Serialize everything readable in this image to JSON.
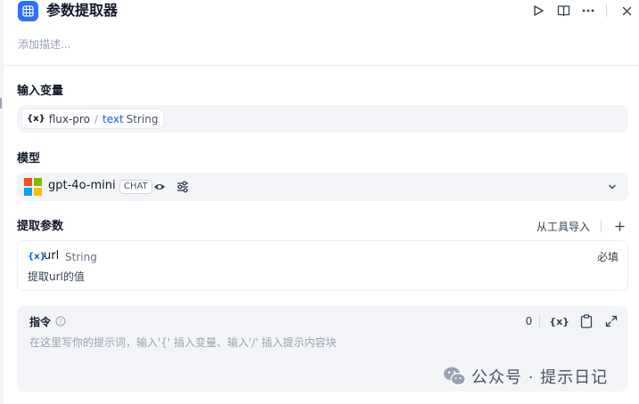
{
  "header": {
    "title": "参数提取器",
    "run_icon": "play-icon",
    "doc_icon": "book-icon",
    "more_icon": "more-icon",
    "close_icon": "close-icon"
  },
  "description": {
    "placeholder": "添加描述..."
  },
  "input_vars": {
    "label": "输入变量",
    "chip": {
      "var_symbol": "{x}",
      "node": "flux-pro",
      "separator": "/",
      "name": "text",
      "type": "String"
    }
  },
  "model": {
    "label": "模型",
    "name": "gpt-4o-mini",
    "badge": "CHAT",
    "provider_icon": "microsoft-logo-icon",
    "colors": {
      "red": "#f25022",
      "green": "#7fba00",
      "blue": "#00a4ef",
      "yellow": "#ffb900"
    }
  },
  "extract": {
    "label": "提取参数",
    "import_label": "从工具导入",
    "params": [
      {
        "var_symbol": "{x}",
        "name": "url",
        "type": "String",
        "required": "必填",
        "description": "提取url的值"
      }
    ]
  },
  "instruction": {
    "label": "指令",
    "placeholder": "在这里写你的提示词，输入'{' 插入变量、输入'/' 插入提示内容块",
    "count": "0",
    "var_tool": "{x}"
  },
  "watermark": {
    "text": "公众号 · 提示日记"
  },
  "colors": {
    "accent": "#2970ff",
    "link": "#155eef"
  }
}
